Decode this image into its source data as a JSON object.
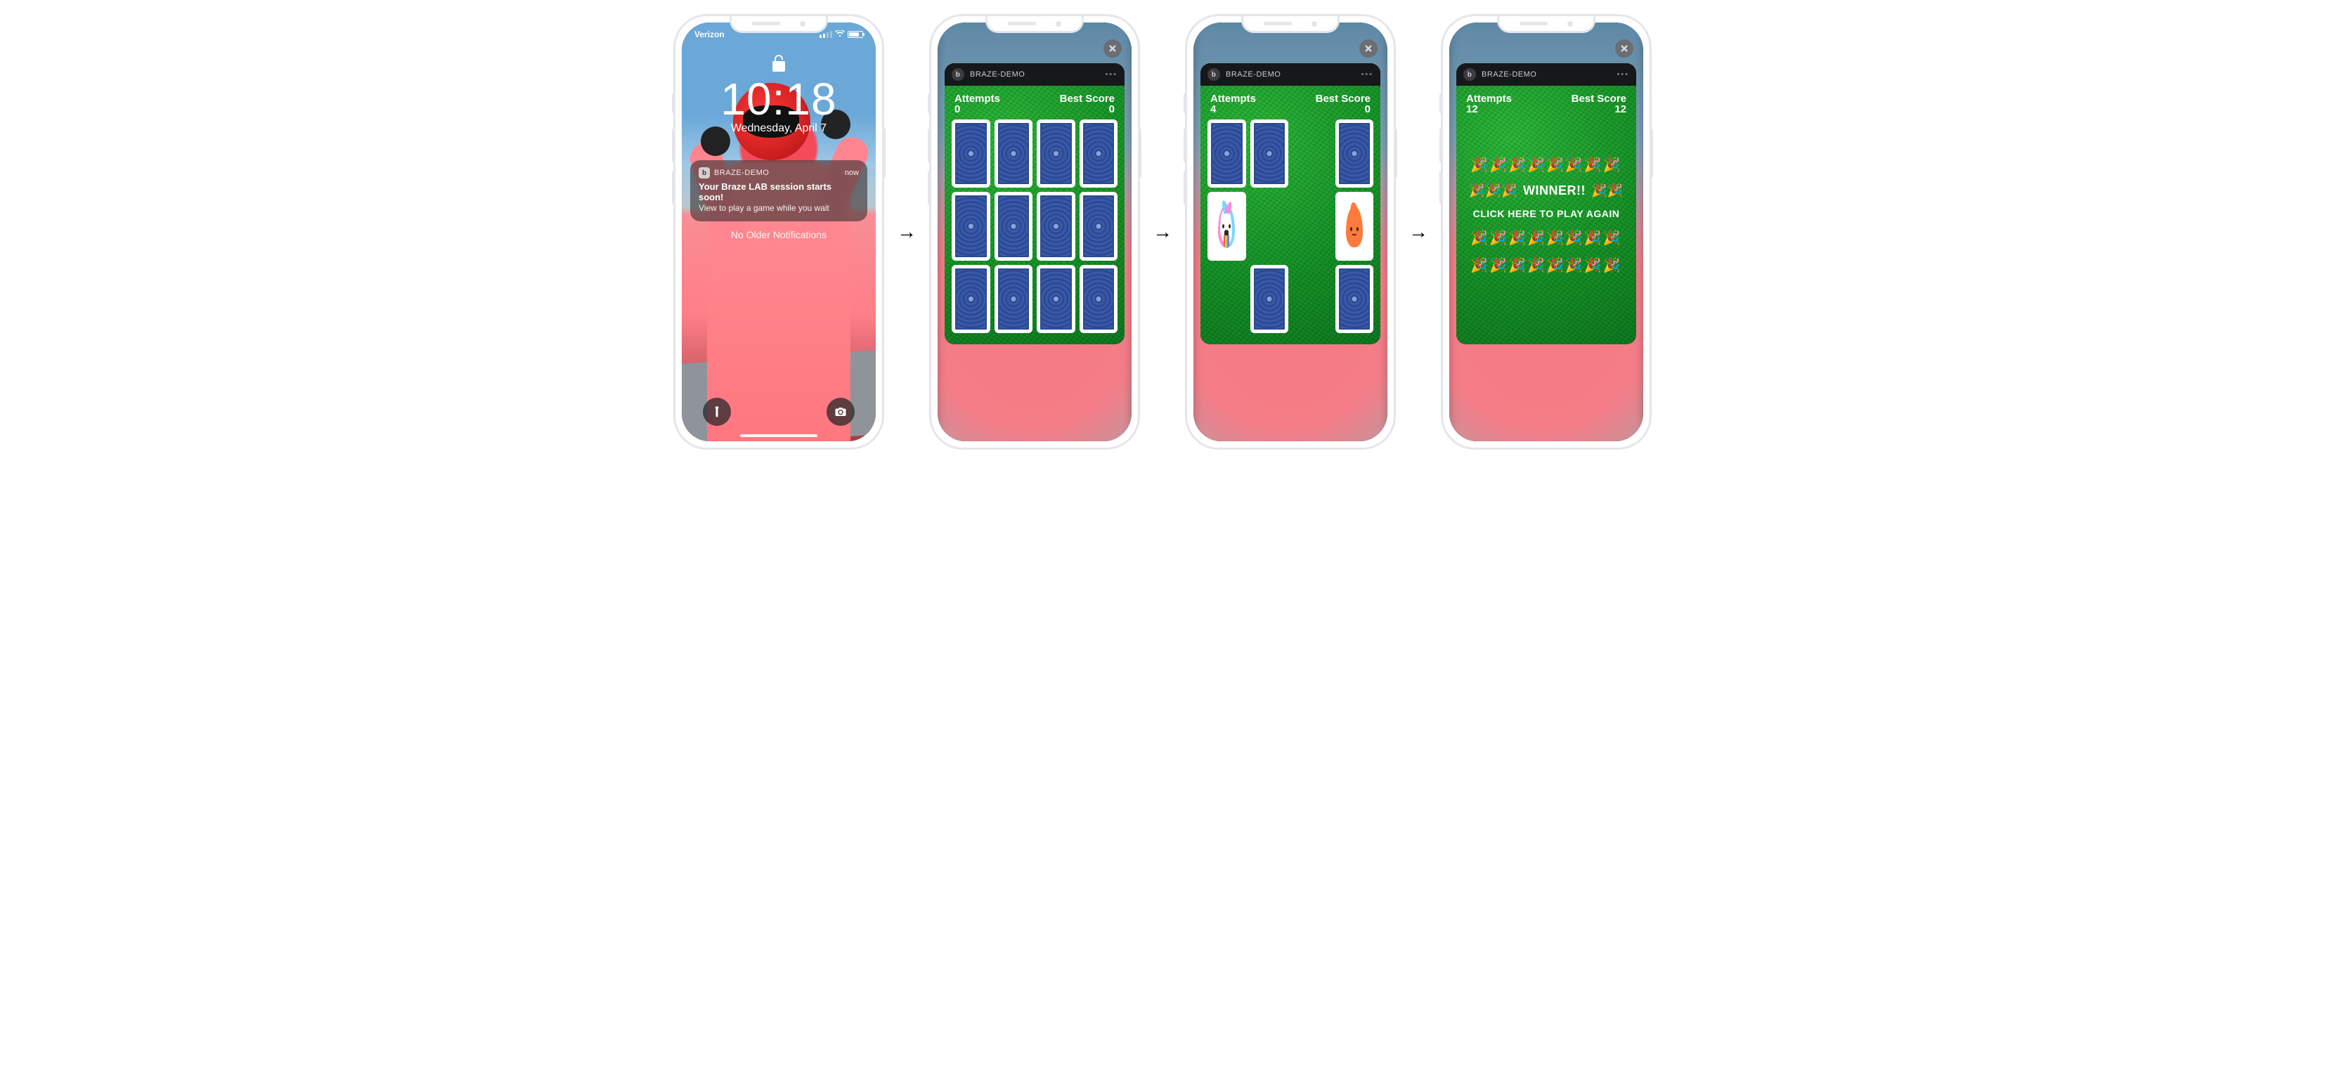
{
  "lock": {
    "carrier": "Verizon",
    "time": "10:18",
    "date": "Wednesday, April 7",
    "notification": {
      "app_name": "BRAZE-DEMO",
      "timestamp": "now",
      "title": "Your Braze LAB session starts soon!",
      "body": "View to play a game while you wait"
    },
    "no_older": "No Older Notifications"
  },
  "sheet": {
    "app_name": "BRAZE-DEMO"
  },
  "labels": {
    "attempts": "Attempts",
    "best_score": "Best Score",
    "winner": "WINNER!!",
    "play_again": "CLICK HERE TO PLAY AGAIN"
  },
  "game_start": {
    "attempts": "0",
    "best_score": "0"
  },
  "game_mid": {
    "attempts": "4",
    "best_score": "0"
  },
  "game_win": {
    "attempts": "12",
    "best_score": "12"
  },
  "emoji": {
    "row8": "🎉🎉🎉🎉🎉🎉🎉🎉",
    "row2": "🎉🎉",
    "row3": "🎉🎉🎉"
  }
}
